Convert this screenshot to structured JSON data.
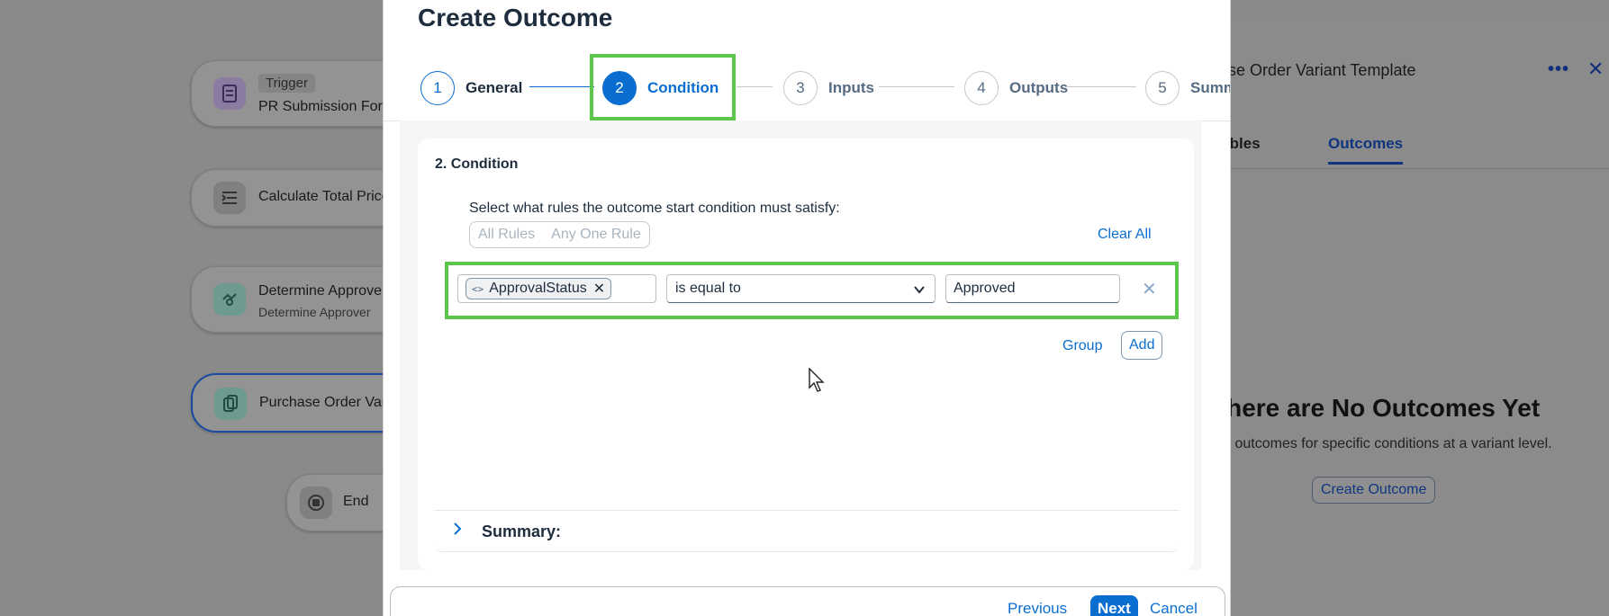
{
  "canvas": {
    "trigger_tag": "Trigger",
    "trigger_label": "PR Submission Form",
    "node_calc": "Calculate Total Price",
    "node_approver": "Determine Approver",
    "node_approver_sub": "Determine Approver",
    "node_po": "Purchase Order Variant Template",
    "node_end": "End"
  },
  "side_panel": {
    "title": "Purchase Order Variant Template",
    "more_icon": "more-icon",
    "close_icon": "close-icon",
    "tabs": [
      "Variables",
      "Outcomes"
    ],
    "empty_title": "There are No Outcomes Yet",
    "empty_desc": "Create outcomes for specific conditions at a variant level.",
    "create_button": "Create Outcome"
  },
  "dialog": {
    "title": "Create Outcome",
    "steps": [
      {
        "num": "1",
        "label": "General"
      },
      {
        "num": "2",
        "label": "Condition"
      },
      {
        "num": "3",
        "label": "Inputs"
      },
      {
        "num": "4",
        "label": "Outputs"
      },
      {
        "num": "5",
        "label": "Summary"
      }
    ],
    "section_title": "2. Condition",
    "rules_prompt": "Select what rules the outcome start condition must satisfy:",
    "seg_all": "All Rules",
    "seg_any": "Any One Rule",
    "clear_all": "Clear All",
    "rule": {
      "token": "ApprovalStatus",
      "operator": "is equal to",
      "value": "Approved"
    },
    "group": "Group",
    "add": "Add",
    "summary": "Summary:",
    "footer": {
      "previous": "Previous",
      "next": "Next",
      "cancel": "Cancel"
    }
  },
  "colors": {
    "accent": "#0a6ed1",
    "highlight": "#5ac74a"
  }
}
